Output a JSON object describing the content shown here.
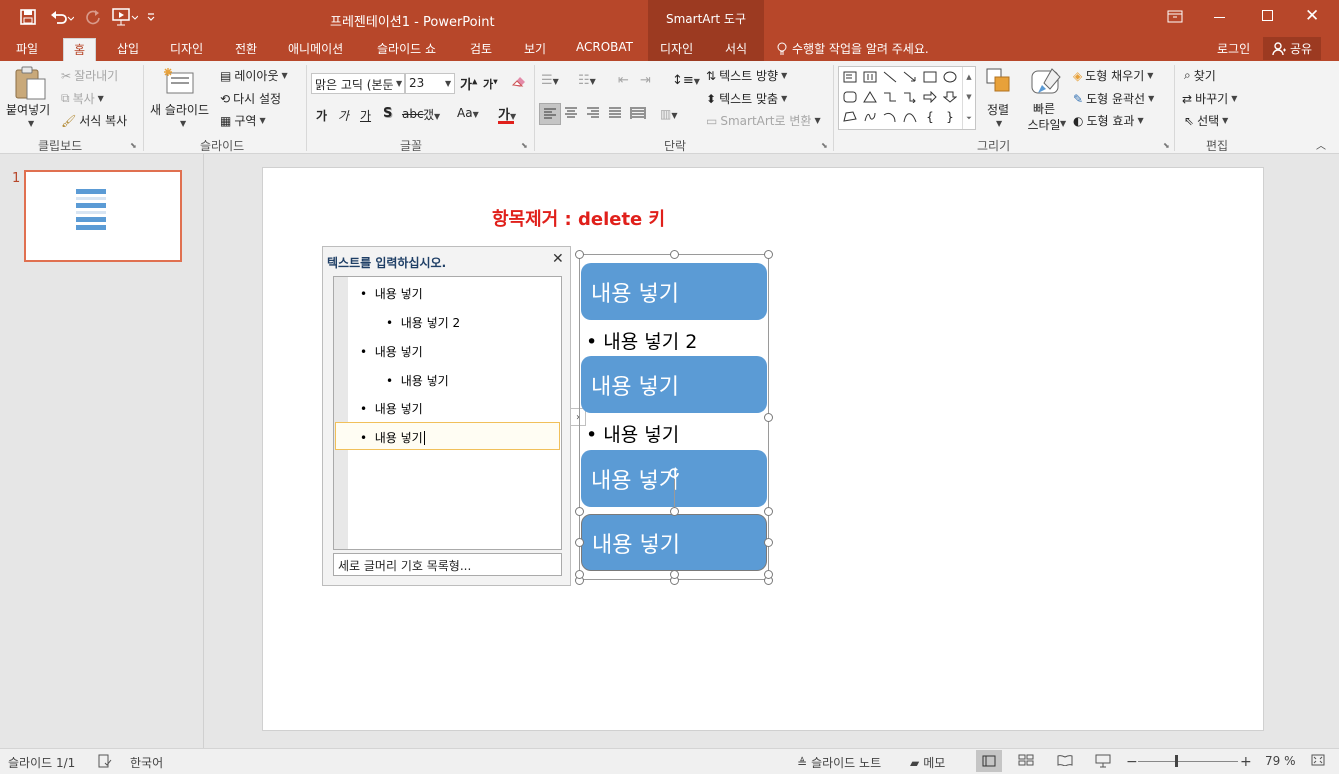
{
  "window": {
    "title": "프레젠테이션1 - PowerPoint",
    "context_tab_group": "SmartArt 도구",
    "tell_me": "수행할 작업을 알려 주세요.",
    "login": "로그인",
    "share": "공유"
  },
  "tabs": [
    "파일",
    "홈",
    "삽입",
    "디자인",
    "전환",
    "애니메이션",
    "슬라이드 쇼",
    "검토",
    "보기",
    "ACROBAT",
    "디자인",
    "서식"
  ],
  "ribbon": {
    "clipboard": {
      "paste": "붙여넣기",
      "cut": "잘라내기",
      "copy": "복사",
      "format_painter": "서식 복사",
      "label": "클립보드"
    },
    "slides": {
      "new_slide": "새 슬라이드",
      "layout": "레이아웃",
      "reset": "다시 설정",
      "section": "구역",
      "label": "슬라이드"
    },
    "font": {
      "font_name": "맑은 고딕 (본둔",
      "font_size": "23",
      "label": "글꼴",
      "bold": "가",
      "italic": "가",
      "underline": "가",
      "strike": "S",
      "spacing": "갰",
      "case": "Aa",
      "color": "가"
    },
    "paragraph": {
      "text_direction": "텍스트 방향",
      "align_text": "텍스트 맞춤",
      "smartart_convert": "SmartArt로 변환",
      "label": "단락"
    },
    "drawing": {
      "arrange": "정렬",
      "quick_styles": "빠른 스타일",
      "fill": "도형 채우기",
      "outline": "도형 윤곽선",
      "effects": "도형 효과",
      "label": "그리기"
    },
    "editing": {
      "find": "찾기",
      "replace": "바꾸기",
      "select": "선택",
      "label": "편집"
    }
  },
  "thumbnail": {
    "number": "1"
  },
  "slide": {
    "title": "항목제거 : delete 키",
    "text_pane": {
      "title": "텍스트를 입력하십시오.",
      "items": [
        {
          "level": 1,
          "text": "내용 넣기"
        },
        {
          "level": 2,
          "text": "내용 넣기 2"
        },
        {
          "level": 1,
          "text": "내용 넣기"
        },
        {
          "level": 2,
          "text": "내용 넣기"
        },
        {
          "level": 1,
          "text": "내용 넣기"
        },
        {
          "level": 1,
          "text": "내용 넣기"
        }
      ],
      "footer": "세로 글머리 기호 목록형..."
    },
    "smartart": {
      "boxes": [
        "내용 넣기",
        "내용 넣기",
        "내용 넣기",
        "내용 넣기"
      ],
      "subitems": [
        "내용 넣기 2",
        "내용 넣기"
      ],
      "box_color": "#5b9bd5"
    }
  },
  "status": {
    "slide_count": "슬라이드 1/1",
    "language": "한국어",
    "notes": "슬라이드 노트",
    "comments": "메모",
    "zoom": "79 %",
    "zoom_level": 0.79
  },
  "colors": {
    "accent": "#b7472a",
    "title_red": "#e0201b"
  }
}
